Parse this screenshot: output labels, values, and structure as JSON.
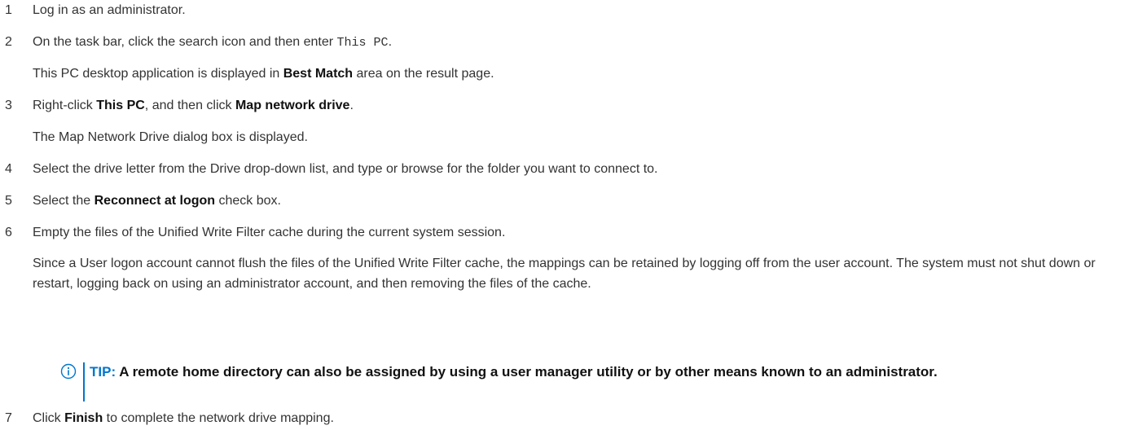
{
  "steps": [
    {
      "num": "1",
      "segments": [
        {
          "t": "Log in as an administrator.",
          "s": "n"
        }
      ]
    },
    {
      "num": "2",
      "segments": [
        {
          "t": "On the task bar, click the search icon and then enter ",
          "s": "n"
        },
        {
          "t": "This PC",
          "s": "m"
        },
        {
          "t": ".",
          "s": "n"
        }
      ]
    },
    {
      "num": "",
      "segments": [
        {
          "t": "This PC desktop application is displayed in ",
          "s": "n"
        },
        {
          "t": "Best Match",
          "s": "b"
        },
        {
          "t": " area on the result page.",
          "s": "n"
        }
      ]
    },
    {
      "num": "3",
      "segments": [
        {
          "t": "Right-click ",
          "s": "n"
        },
        {
          "t": "This PC",
          "s": "b"
        },
        {
          "t": ", and then click ",
          "s": "n"
        },
        {
          "t": "Map network drive",
          "s": "b"
        },
        {
          "t": ".",
          "s": "n"
        }
      ]
    },
    {
      "num": "",
      "segments": [
        {
          "t": "The Map Network Drive dialog box is displayed.",
          "s": "n"
        }
      ]
    },
    {
      "num": "4",
      "segments": [
        {
          "t": "Select the drive letter from the Drive drop-down list, and type or browse for the folder you want to connect to.",
          "s": "n"
        }
      ]
    },
    {
      "num": "5",
      "segments": [
        {
          "t": "Select the ",
          "s": "n"
        },
        {
          "t": "Reconnect at logon",
          "s": "b"
        },
        {
          "t": " check box.",
          "s": "n"
        }
      ]
    },
    {
      "num": "6",
      "segments": [
        {
          "t": "Empty the files of the Unified Write Filter cache during the current system session.",
          "s": "n"
        }
      ]
    }
  ],
  "step6_note": "Since a User logon account cannot flush the files of the Unified Write Filter cache, the mappings can be retained by logging off from the user account. The system must not shut down or restart, logging back on using an administrator account, and then removing the files of the cache.",
  "tip": {
    "label": "TIP:",
    "text": " A remote home directory can also be assigned by using a user manager utility or by other means known to an administrator.",
    "icon": "info-circle-icon",
    "accent_color": "#0076ce"
  },
  "step7": {
    "num": "7",
    "segments": [
      {
        "t": "Click ",
        "s": "n"
      },
      {
        "t": "Finish",
        "s": "b"
      },
      {
        "t": " to complete the network drive mapping.",
        "s": "n"
      }
    ]
  }
}
